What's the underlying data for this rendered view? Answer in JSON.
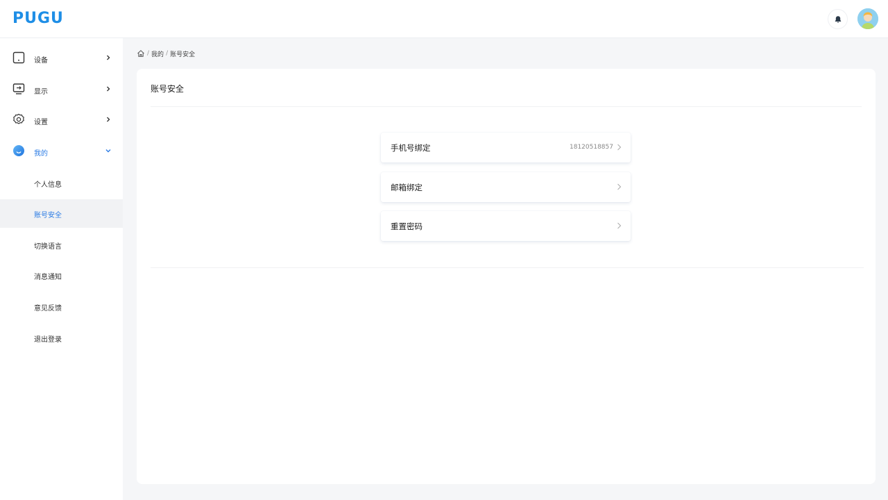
{
  "header": {
    "logo": "PUGU",
    "brand_color": "#1e8ee6",
    "icons": [
      "bell-icon",
      "avatar"
    ]
  },
  "sidebar": {
    "items": [
      {
        "label": "设备",
        "icon": "device-icon",
        "expanded": false
      },
      {
        "label": "显示",
        "icon": "monitor-icon",
        "expanded": false
      },
      {
        "label": "设置",
        "icon": "gear-icon",
        "expanded": false
      },
      {
        "label": "我的",
        "icon": "profile-icon",
        "expanded": true,
        "active": true
      }
    ],
    "sub_items": [
      {
        "label": "个人信息"
      },
      {
        "label": "账号安全",
        "selected": true
      },
      {
        "label": "切换语言"
      },
      {
        "label": "消息通知"
      },
      {
        "label": "意见反馈"
      },
      {
        "label": "退出登录"
      }
    ],
    "active_color": "#2a7be4"
  },
  "breadcrumb": {
    "items": [
      "我的",
      "账号安全"
    ],
    "separator": "/"
  },
  "main": {
    "title": "账号安全",
    "rows": [
      {
        "label": "手机号绑定",
        "value": "18120518857"
      },
      {
        "label": "邮箱绑定",
        "value": ""
      },
      {
        "label": "重置密码",
        "value": ""
      }
    ]
  }
}
